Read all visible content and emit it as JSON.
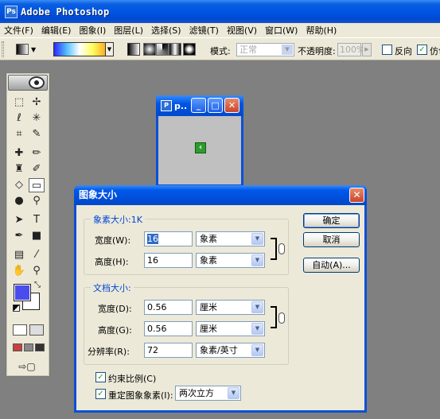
{
  "window": {
    "title": "Adobe Photoshop",
    "logo": "Ps"
  },
  "menu": {
    "items": [
      "文件(F)",
      "编辑(E)",
      "图象(I)",
      "图层(L)",
      "选择(S)",
      "滤镜(T)",
      "视图(V)",
      "窗口(W)",
      "帮助(H)"
    ]
  },
  "options": {
    "mode_label": "模式:",
    "mode_value": "正常",
    "opacity_label": "不透明度:",
    "opacity_value": "100%",
    "reverse_label": "反向",
    "dither_label": "仿色"
  },
  "document": {
    "title": "p.."
  },
  "dialog": {
    "title": "图象大小",
    "pixel_dims": {
      "legend": "象素大小:1K",
      "width_label": "宽度(W):",
      "width_value": "16",
      "width_unit": "象素",
      "height_label": "高度(H):",
      "height_value": "16",
      "height_unit": "象素"
    },
    "doc_size": {
      "legend": "文档大小:",
      "width_label": "宽度(D):",
      "width_value": "0.56",
      "width_unit": "厘米",
      "height_label": "高度(G):",
      "height_value": "0.56",
      "height_unit": "厘米",
      "resolution_label": "分辨率(R):",
      "resolution_value": "72",
      "resolution_unit": "象素/英寸"
    },
    "constrain_label": "约束比例(C)",
    "resample_label": "重定图象象素(I):",
    "resample_value": "两次立方",
    "ok_label": "确定",
    "cancel_label": "取消",
    "auto_label": "自动(A)..."
  },
  "colors": {
    "title_blue": "#0054e3",
    "foreground": "#4a4dec",
    "background": "#ffffff",
    "workspace": "#808080"
  }
}
